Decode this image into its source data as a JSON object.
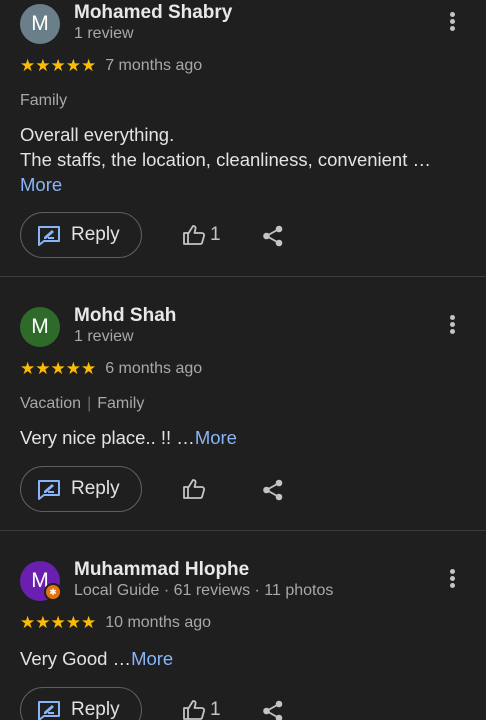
{
  "colors": {
    "background": "#1f1f1f",
    "star": "#fbbc04",
    "link": "#8ab4f8",
    "avatar_1": "#6b7f8a",
    "avatar_2": "#2e6b2a",
    "avatar_3": "#6a1fb0",
    "local_guide_badge": "#e8710a"
  },
  "actions": {
    "reply_label": "Reply",
    "more_label": "More",
    "reply_icon": "edit-reply-icon",
    "like_icon": "thumbs-up-icon",
    "share_icon": "share-icon",
    "menu_icon": "more-vert-icon"
  },
  "reviews": [
    {
      "avatar_letter": "M",
      "name": "Mohamed Shabry",
      "subtitle": "1 review",
      "stars": "★★★★★",
      "rating": 5,
      "date": "7 months ago",
      "tag_1": "Family",
      "text_line_1": "Overall everything.",
      "text_line_2": "The staffs, the location, cleanliness, convenient …",
      "likes": "1"
    },
    {
      "avatar_letter": "M",
      "name": "Mohd Shah",
      "subtitle": "1 review",
      "stars": "★★★★★",
      "rating": 5,
      "date": "6 months ago",
      "tag_1": "Vacation",
      "tag_2": "Family",
      "tag_separator": "|",
      "text": "Very nice place.. !! …",
      "likes": ""
    },
    {
      "avatar_letter": "M",
      "name": "Muhammad Hlophe",
      "subtitle": "Local Guide · 61 reviews · 11 photos",
      "stars": "★★★★★",
      "rating": 5,
      "date": "10 months ago",
      "text": "Very Good …",
      "likes": "1"
    }
  ]
}
